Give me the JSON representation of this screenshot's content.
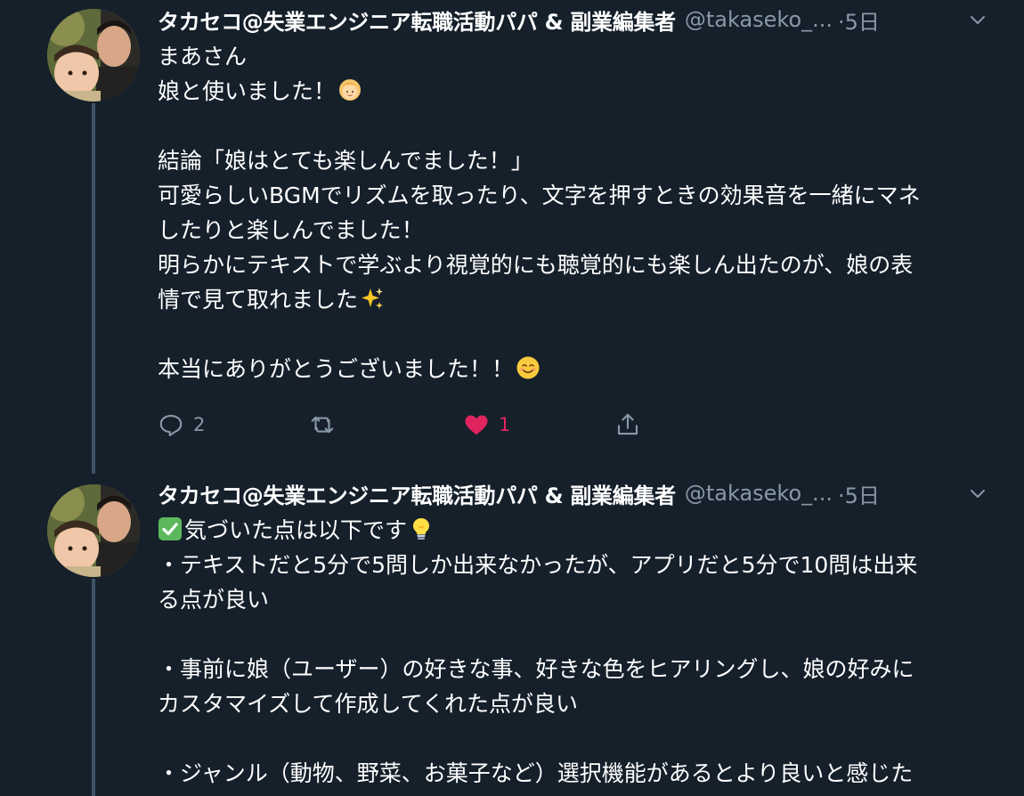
{
  "tweets": [
    {
      "author": {
        "display_name": "タカセコ@失業エンジニア転職活動パパ & 副業編集者",
        "handle": "@takaseko_...",
        "time": "·5日"
      },
      "body_lines": [
        "まあさん",
        "娘と使いました！",
        "",
        "結論「娘はとても楽しんでました！」",
        "可愛らしいBGMでリズムを取ったり、文字を押すときの効果音を一緒にマネ",
        "したりと楽しんでました！",
        "明らかにテキストで学ぶより視覚的にも聴覚的にも楽しん出たのが、娘の表",
        "情で見て取れました",
        "",
        "本当にありがとうございました！！"
      ],
      "actions": {
        "reply_count": "2",
        "retweet_count": "",
        "like_count": "1"
      },
      "icons": {
        "reply": "comment-icon",
        "retweet": "retweet-icon",
        "like": "heart-icon",
        "share": "share-icon",
        "caret": "chevron-down-icon"
      },
      "emojis": [
        "girl-emoji",
        "sparkles-emoji",
        "smiling-face-emoji"
      ]
    },
    {
      "author": {
        "display_name": "タカセコ@失業エンジニア転職活動パパ & 副業編集者",
        "handle": "@takaseko_...",
        "time": "·5日"
      },
      "body_lines": [
        "気づいた点は以下です",
        "・テキストだと5分で5問しか出来なかったが、アプリだと5分で10問は出来",
        "る点が良い",
        "",
        "・事前に娘（ユーザー）の好きな事、好きな色をヒアリングし、娘の好みに",
        "カスタマイズして作成してくれた点が良い",
        "",
        "・ジャンル（動物、野菜、お菓子など）選択機能があるとより良いと感じた"
      ],
      "emojis": [
        "check-mark-button-emoji",
        "light-bulb-emoji"
      ]
    }
  ],
  "colors": {
    "background": "#15202b",
    "text_primary": "#ffffff",
    "text_secondary": "#8899a6",
    "like_active": "#e0245e",
    "thread_line": "#3d5466"
  }
}
